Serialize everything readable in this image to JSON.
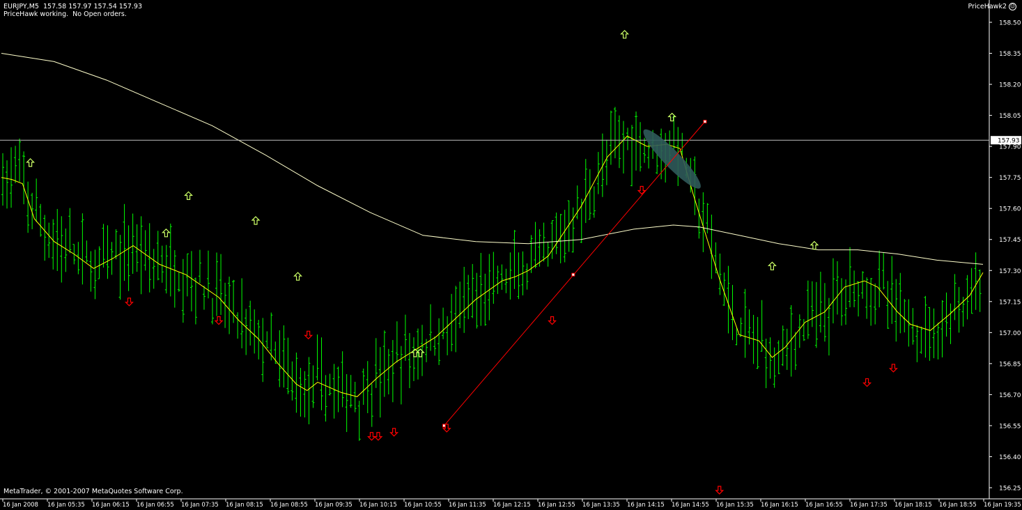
{
  "header": {
    "symbol_line": "EURJPY,M5  157.58 157.97 157.54 157.93",
    "status_line": "PriceHawk working.  No Open orders.",
    "expert_name": "PriceHawk2",
    "expert_icon": "smiley-icon"
  },
  "footer": {
    "copyright": "MetaTrader, © 2001-2007 MetaQuotes Software Corp."
  },
  "colors": {
    "background": "#000000",
    "bars": "#00ff00",
    "fast_ma": "#ffff00",
    "slow_ma": "#ffffcc",
    "trendline": "#ff0000",
    "up_arrow": "#ccff66",
    "down_arrow": "#ff0000",
    "grid_line": "#c0c0c0",
    "highlight_ellipse": "#2f5a5a"
  },
  "chart_data": {
    "type": "ohlc-bar",
    "symbol": "EURJPY",
    "timeframe": "M5",
    "ylim": [
      156.2,
      158.6
    ],
    "y_ticks": [
      "158.50",
      "158.35",
      "158.20",
      "158.05",
      "157.90",
      "157.75",
      "157.60",
      "157.45",
      "157.30",
      "157.15",
      "157.00",
      "156.85",
      "156.70",
      "156.55",
      "156.40",
      "156.25"
    ],
    "x_ticks": [
      "16 Jan 2008",
      "16 Jan 05:35",
      "16 Jan 06:15",
      "16 Jan 06:55",
      "16 Jan 07:35",
      "16 Jan 08:15",
      "16 Jan 08:55",
      "16 Jan 09:35",
      "16 Jan 10:15",
      "16 Jan 10:55",
      "16 Jan 11:35",
      "16 Jan 12:15",
      "16 Jan 12:55",
      "16 Jan 13:35",
      "16 Jan 14:15",
      "16 Jan 14:55",
      "16 Jan 15:35",
      "16 Jan 16:15",
      "16 Jan 16:55",
      "16 Jan 17:35",
      "16 Jan 18:15",
      "16 Jan 18:55",
      "16 Jan 19:35"
    ],
    "current_price": "157.93",
    "bar_count": 234,
    "series": [
      {
        "color_key": "fast_ma",
        "points": [
          [
            0,
            157.75
          ],
          [
            8,
            157.74
          ],
          [
            16,
            157.72
          ],
          [
            25,
            157.55
          ],
          [
            40,
            157.44
          ],
          [
            55,
            157.38
          ],
          [
            70,
            157.31
          ],
          [
            85,
            157.36
          ],
          [
            100,
            157.42
          ],
          [
            120,
            157.33
          ],
          [
            140,
            157.28
          ],
          [
            165,
            157.17
          ],
          [
            180,
            157.06
          ],
          [
            195,
            156.97
          ],
          [
            210,
            156.85
          ],
          [
            224,
            156.75
          ],
          [
            232,
            156.72
          ],
          [
            240,
            156.76
          ],
          [
            258,
            156.71
          ],
          [
            270,
            156.69
          ],
          [
            285,
            156.78
          ],
          [
            300,
            156.86
          ],
          [
            330,
            156.98
          ],
          [
            360,
            157.16
          ],
          [
            380,
            157.25
          ],
          [
            390,
            157.27
          ],
          [
            400,
            157.3
          ],
          [
            415,
            157.37
          ],
          [
            440,
            157.61
          ],
          [
            460,
            157.85
          ],
          [
            475,
            157.95
          ],
          [
            490,
            157.9
          ],
          [
            505,
            157.91
          ],
          [
            515,
            157.89
          ],
          [
            525,
            157.67
          ],
          [
            545,
            157.26
          ],
          [
            560,
            156.99
          ],
          [
            575,
            156.96
          ],
          [
            585,
            156.88
          ],
          [
            595,
            156.93
          ],
          [
            610,
            157.05
          ],
          [
            625,
            157.1
          ],
          [
            640,
            157.22
          ],
          [
            655,
            157.25
          ],
          [
            665,
            157.22
          ],
          [
            680,
            157.1
          ],
          [
            690,
            157.04
          ],
          [
            705,
            157.01
          ],
          [
            720,
            157.09
          ],
          [
            735,
            157.18
          ],
          [
            745,
            157.29
          ]
        ]
      },
      {
        "color_key": "slow_ma",
        "points": [
          [
            0,
            158.35
          ],
          [
            40,
            158.31
          ],
          [
            80,
            158.22
          ],
          [
            120,
            158.11
          ],
          [
            160,
            158.0
          ],
          [
            200,
            157.86
          ],
          [
            240,
            157.71
          ],
          [
            280,
            157.58
          ],
          [
            320,
            157.47
          ],
          [
            360,
            157.44
          ],
          [
            400,
            157.43
          ],
          [
            440,
            157.45
          ],
          [
            480,
            157.5
          ],
          [
            510,
            157.52
          ],
          [
            530,
            157.51
          ],
          [
            560,
            157.47
          ],
          [
            590,
            157.43
          ],
          [
            620,
            157.4
          ],
          [
            650,
            157.4
          ],
          [
            680,
            157.38
          ],
          [
            710,
            157.35
          ],
          [
            745,
            157.33
          ]
        ]
      }
    ],
    "trendline": [
      [
        336,
        156.55
      ],
      [
        434,
        157.28
      ],
      [
        534,
        158.02
      ]
    ],
    "up_arrows": [
      [
        22,
        157.82
      ],
      [
        142,
        157.66
      ],
      [
        125,
        157.48
      ],
      [
        193,
        157.54
      ],
      [
        225,
        157.27
      ],
      [
        314,
        156.9
      ],
      [
        318,
        156.9
      ],
      [
        473,
        158.44
      ],
      [
        509,
        158.04
      ],
      [
        585,
        157.32
      ],
      [
        617,
        157.42
      ]
    ],
    "down_arrows": [
      [
        97,
        157.15
      ],
      [
        165,
        157.06
      ],
      [
        233,
        156.99
      ],
      [
        281,
        156.5
      ],
      [
        286,
        156.5
      ],
      [
        298,
        156.52
      ],
      [
        338,
        156.54
      ],
      [
        418,
        157.06
      ],
      [
        486,
        157.69
      ],
      [
        545,
        156.24
      ],
      [
        657,
        156.76
      ],
      [
        677,
        156.83
      ]
    ],
    "highlight_ellipse": {
      "x_bar": 509,
      "y_price": 157.92
    }
  }
}
